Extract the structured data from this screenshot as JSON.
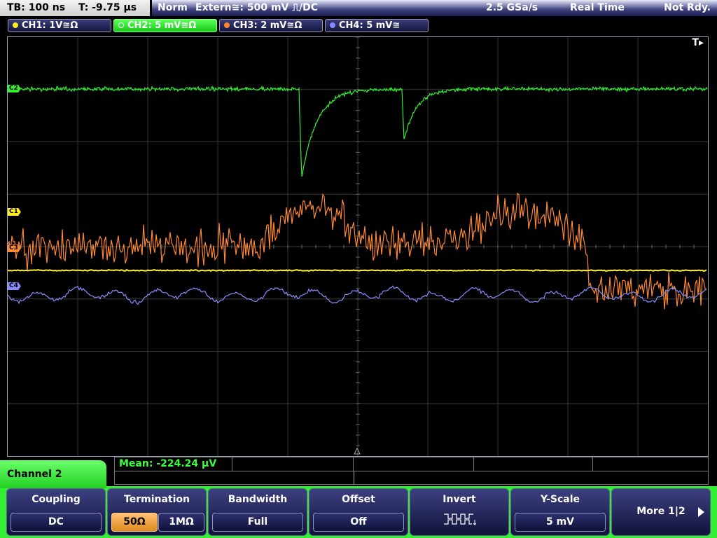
{
  "timebase": {
    "tb": "TB: 100 ns",
    "t": "T: -9.75 µs"
  },
  "status": {
    "mode": "Norm",
    "trigger": "Extern≅: 500 mV ⎍/DC",
    "sample_rate": "2.5 GSa/s",
    "acq_mode": "Real Time",
    "state": "Not Rdy."
  },
  "channels": [
    {
      "label": "CH1: 1V≅Ω",
      "color": "#ffee22",
      "active": false,
      "level_tag": "C1"
    },
    {
      "label": "CH2: 5 mV≅Ω",
      "color": "#33ee33",
      "active": true,
      "level_tag": "C2"
    },
    {
      "label": "CH3: 2 mV≅Ω",
      "color": "#ff8833",
      "active": false,
      "level_tag": "C3"
    },
    {
      "label": "CH4: 5 mV≅",
      "color": "#8888ff",
      "active": false,
      "level_tag": "C4"
    }
  ],
  "trigger_marker": "T▸",
  "measurement": {
    "mean": "Mean: -224.24 µV"
  },
  "menu": {
    "title": "Channel 2",
    "coupling": {
      "label": "Coupling",
      "value": "DC"
    },
    "termination": {
      "label": "Termination",
      "options": [
        "50Ω",
        "1MΩ"
      ],
      "selected": 0
    },
    "bandwidth": {
      "label": "Bandwidth",
      "value": "Full"
    },
    "offset": {
      "label": "Offset",
      "value": "Off"
    },
    "invert": {
      "label": "Invert",
      "icon": "inverted-square-wave-icon"
    },
    "yscale": {
      "label": "Y-Scale",
      "value": "5 mV"
    },
    "more": {
      "label": "More 1|2"
    }
  }
}
